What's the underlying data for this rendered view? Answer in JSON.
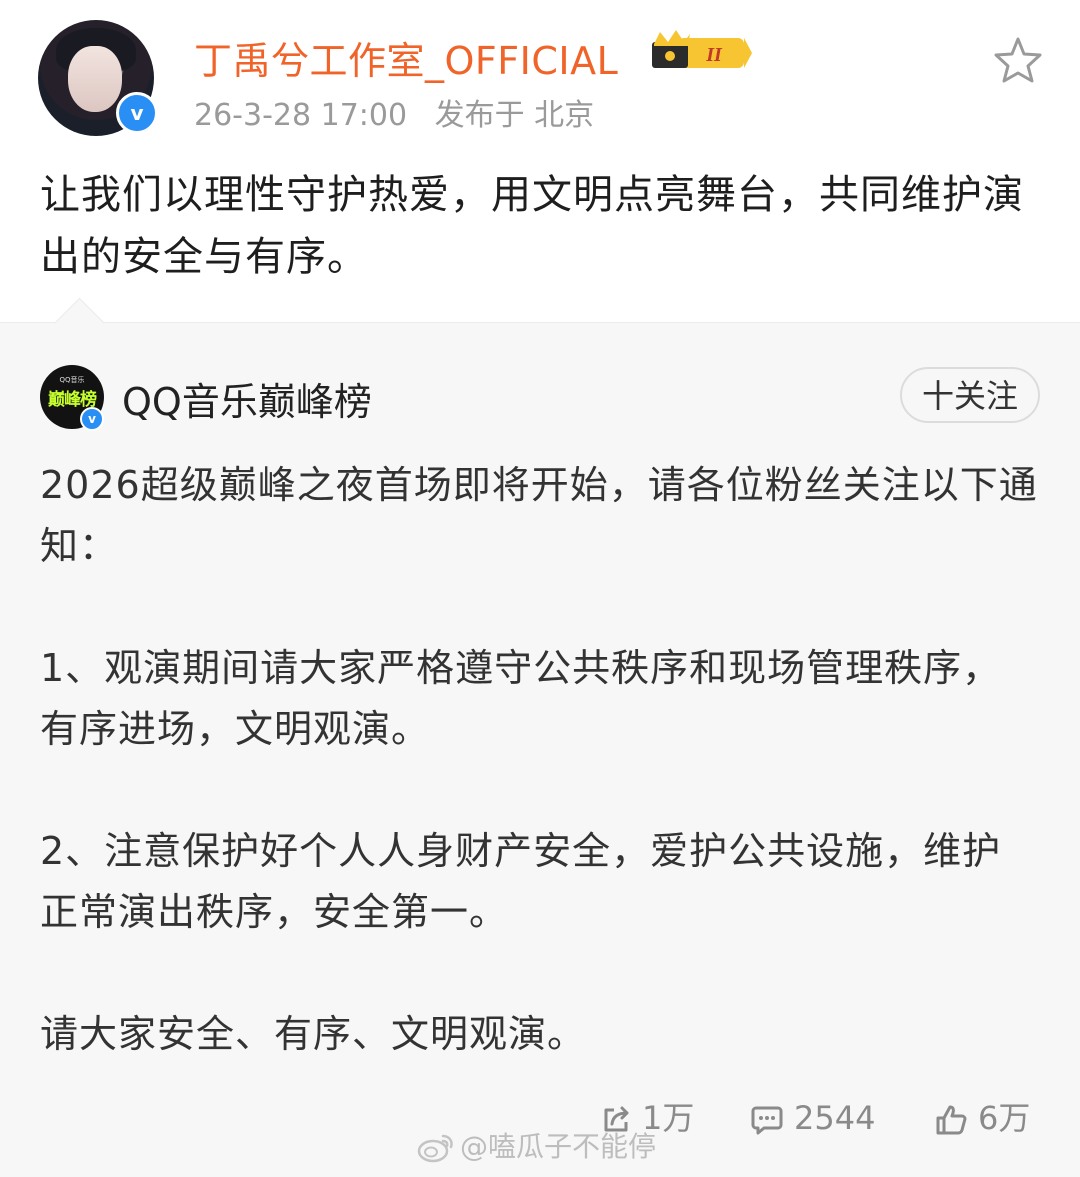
{
  "post": {
    "author": "丁禹兮工作室_OFFICIAL",
    "vip_level": "II",
    "timestamp": "26-3-28 17:00",
    "location": "发布于 北京",
    "text": "让我们以理性守护热爱，用文明点亮舞台，共同维护演出的安全与有序。"
  },
  "quoted": {
    "author": "QQ音乐巅峰榜",
    "avatar_logo": "巅峰榜",
    "avatar_small": "QQ音乐",
    "follow_label": "十关注",
    "paragraphs": [
      "2026超级巅峰之夜首场即将开始，请各位粉丝关注以下通知：",
      "1、观演期间请大家严格遵守公共秩序和现场管理秩序，有序进场，文明观演。",
      "2、注意保护好个人人身财产安全，爱护公共设施，维护正常演出秩序，安全第一。",
      "请大家安全、有序、文明观演。"
    ],
    "actions": {
      "repost": "1万",
      "comments": "2544",
      "likes": "6万"
    }
  },
  "watermark": "@嗑瓜子不能停",
  "colors": {
    "author_name": "#f0642a",
    "verified": "#2a8ff5",
    "quote_bg": "#f7f7f7"
  },
  "icons": [
    "star-icon",
    "verified-icon",
    "repost-icon",
    "comment-icon",
    "like-icon",
    "weibo-logo-icon",
    "vip-crown-icon"
  ]
}
